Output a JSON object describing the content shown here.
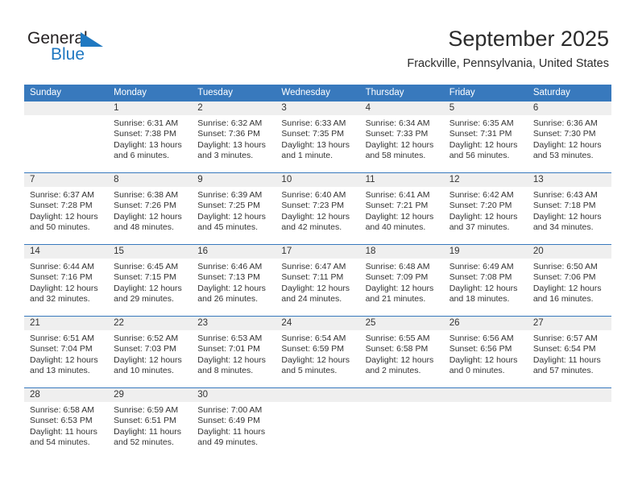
{
  "brand": {
    "name_dark": "General",
    "name_light": "Blue",
    "triangle_icon": "triangle-icon",
    "dark_color": "#231f20",
    "light_color": "#1f78c1"
  },
  "header": {
    "title": "September 2025",
    "subtitle": "Frackville, Pennsylvania, United States",
    "accent_color": "#3879bd",
    "daynum_bg": "#efefef"
  },
  "weekday_headers": [
    "Sunday",
    "Monday",
    "Tuesday",
    "Wednesday",
    "Thursday",
    "Friday",
    "Saturday"
  ],
  "weeks": [
    [
      {
        "day": "",
        "empty": true,
        "sunrise": "",
        "sunset": "",
        "daylight_1": "",
        "daylight_2": ""
      },
      {
        "day": "1",
        "sunrise": "Sunrise: 6:31 AM",
        "sunset": "Sunset: 7:38 PM",
        "daylight_1": "Daylight: 13 hours",
        "daylight_2": "and 6 minutes."
      },
      {
        "day": "2",
        "sunrise": "Sunrise: 6:32 AM",
        "sunset": "Sunset: 7:36 PM",
        "daylight_1": "Daylight: 13 hours",
        "daylight_2": "and 3 minutes."
      },
      {
        "day": "3",
        "sunrise": "Sunrise: 6:33 AM",
        "sunset": "Sunset: 7:35 PM",
        "daylight_1": "Daylight: 13 hours",
        "daylight_2": "and 1 minute."
      },
      {
        "day": "4",
        "sunrise": "Sunrise: 6:34 AM",
        "sunset": "Sunset: 7:33 PM",
        "daylight_1": "Daylight: 12 hours",
        "daylight_2": "and 58 minutes."
      },
      {
        "day": "5",
        "sunrise": "Sunrise: 6:35 AM",
        "sunset": "Sunset: 7:31 PM",
        "daylight_1": "Daylight: 12 hours",
        "daylight_2": "and 56 minutes."
      },
      {
        "day": "6",
        "sunrise": "Sunrise: 6:36 AM",
        "sunset": "Sunset: 7:30 PM",
        "daylight_1": "Daylight: 12 hours",
        "daylight_2": "and 53 minutes."
      }
    ],
    [
      {
        "day": "7",
        "sunrise": "Sunrise: 6:37 AM",
        "sunset": "Sunset: 7:28 PM",
        "daylight_1": "Daylight: 12 hours",
        "daylight_2": "and 50 minutes."
      },
      {
        "day": "8",
        "sunrise": "Sunrise: 6:38 AM",
        "sunset": "Sunset: 7:26 PM",
        "daylight_1": "Daylight: 12 hours",
        "daylight_2": "and 48 minutes."
      },
      {
        "day": "9",
        "sunrise": "Sunrise: 6:39 AM",
        "sunset": "Sunset: 7:25 PM",
        "daylight_1": "Daylight: 12 hours",
        "daylight_2": "and 45 minutes."
      },
      {
        "day": "10",
        "sunrise": "Sunrise: 6:40 AM",
        "sunset": "Sunset: 7:23 PM",
        "daylight_1": "Daylight: 12 hours",
        "daylight_2": "and 42 minutes."
      },
      {
        "day": "11",
        "sunrise": "Sunrise: 6:41 AM",
        "sunset": "Sunset: 7:21 PM",
        "daylight_1": "Daylight: 12 hours",
        "daylight_2": "and 40 minutes."
      },
      {
        "day": "12",
        "sunrise": "Sunrise: 6:42 AM",
        "sunset": "Sunset: 7:20 PM",
        "daylight_1": "Daylight: 12 hours",
        "daylight_2": "and 37 minutes."
      },
      {
        "day": "13",
        "sunrise": "Sunrise: 6:43 AM",
        "sunset": "Sunset: 7:18 PM",
        "daylight_1": "Daylight: 12 hours",
        "daylight_2": "and 34 minutes."
      }
    ],
    [
      {
        "day": "14",
        "sunrise": "Sunrise: 6:44 AM",
        "sunset": "Sunset: 7:16 PM",
        "daylight_1": "Daylight: 12 hours",
        "daylight_2": "and 32 minutes."
      },
      {
        "day": "15",
        "sunrise": "Sunrise: 6:45 AM",
        "sunset": "Sunset: 7:15 PM",
        "daylight_1": "Daylight: 12 hours",
        "daylight_2": "and 29 minutes."
      },
      {
        "day": "16",
        "sunrise": "Sunrise: 6:46 AM",
        "sunset": "Sunset: 7:13 PM",
        "daylight_1": "Daylight: 12 hours",
        "daylight_2": "and 26 minutes."
      },
      {
        "day": "17",
        "sunrise": "Sunrise: 6:47 AM",
        "sunset": "Sunset: 7:11 PM",
        "daylight_1": "Daylight: 12 hours",
        "daylight_2": "and 24 minutes."
      },
      {
        "day": "18",
        "sunrise": "Sunrise: 6:48 AM",
        "sunset": "Sunset: 7:09 PM",
        "daylight_1": "Daylight: 12 hours",
        "daylight_2": "and 21 minutes."
      },
      {
        "day": "19",
        "sunrise": "Sunrise: 6:49 AM",
        "sunset": "Sunset: 7:08 PM",
        "daylight_1": "Daylight: 12 hours",
        "daylight_2": "and 18 minutes."
      },
      {
        "day": "20",
        "sunrise": "Sunrise: 6:50 AM",
        "sunset": "Sunset: 7:06 PM",
        "daylight_1": "Daylight: 12 hours",
        "daylight_2": "and 16 minutes."
      }
    ],
    [
      {
        "day": "21",
        "sunrise": "Sunrise: 6:51 AM",
        "sunset": "Sunset: 7:04 PM",
        "daylight_1": "Daylight: 12 hours",
        "daylight_2": "and 13 minutes."
      },
      {
        "day": "22",
        "sunrise": "Sunrise: 6:52 AM",
        "sunset": "Sunset: 7:03 PM",
        "daylight_1": "Daylight: 12 hours",
        "daylight_2": "and 10 minutes."
      },
      {
        "day": "23",
        "sunrise": "Sunrise: 6:53 AM",
        "sunset": "Sunset: 7:01 PM",
        "daylight_1": "Daylight: 12 hours",
        "daylight_2": "and 8 minutes."
      },
      {
        "day": "24",
        "sunrise": "Sunrise: 6:54 AM",
        "sunset": "Sunset: 6:59 PM",
        "daylight_1": "Daylight: 12 hours",
        "daylight_2": "and 5 minutes."
      },
      {
        "day": "25",
        "sunrise": "Sunrise: 6:55 AM",
        "sunset": "Sunset: 6:58 PM",
        "daylight_1": "Daylight: 12 hours",
        "daylight_2": "and 2 minutes."
      },
      {
        "day": "26",
        "sunrise": "Sunrise: 6:56 AM",
        "sunset": "Sunset: 6:56 PM",
        "daylight_1": "Daylight: 12 hours",
        "daylight_2": "and 0 minutes."
      },
      {
        "day": "27",
        "sunrise": "Sunrise: 6:57 AM",
        "sunset": "Sunset: 6:54 PM",
        "daylight_1": "Daylight: 11 hours",
        "daylight_2": "and 57 minutes."
      }
    ],
    [
      {
        "day": "28",
        "sunrise": "Sunrise: 6:58 AM",
        "sunset": "Sunset: 6:53 PM",
        "daylight_1": "Daylight: 11 hours",
        "daylight_2": "and 54 minutes."
      },
      {
        "day": "29",
        "sunrise": "Sunrise: 6:59 AM",
        "sunset": "Sunset: 6:51 PM",
        "daylight_1": "Daylight: 11 hours",
        "daylight_2": "and 52 minutes."
      },
      {
        "day": "30",
        "sunrise": "Sunrise: 7:00 AM",
        "sunset": "Sunset: 6:49 PM",
        "daylight_1": "Daylight: 11 hours",
        "daylight_2": "and 49 minutes."
      },
      {
        "day": "",
        "empty": true,
        "sunrise": "",
        "sunset": "",
        "daylight_1": "",
        "daylight_2": ""
      },
      {
        "day": "",
        "empty": true,
        "sunrise": "",
        "sunset": "",
        "daylight_1": "",
        "daylight_2": ""
      },
      {
        "day": "",
        "empty": true,
        "sunrise": "",
        "sunset": "",
        "daylight_1": "",
        "daylight_2": ""
      },
      {
        "day": "",
        "empty": true,
        "sunrise": "",
        "sunset": "",
        "daylight_1": "",
        "daylight_2": ""
      }
    ]
  ]
}
